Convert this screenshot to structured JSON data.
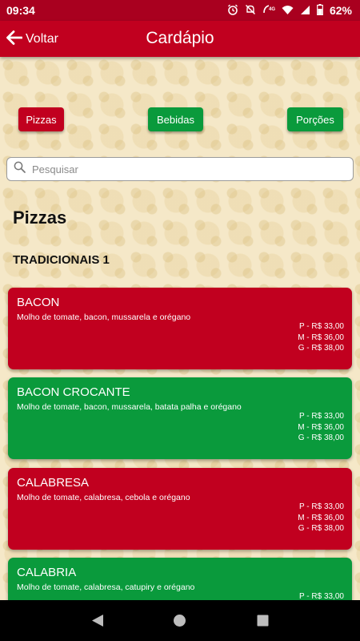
{
  "status_bar": {
    "time": "09:34",
    "battery": "62%",
    "network": "4G",
    "icons": [
      "alarm-icon",
      "mute-icon",
      "signal-4g-icon",
      "wifi-icon",
      "cell-signal-icon",
      "battery-icon"
    ]
  },
  "app_bar": {
    "back_label": "Voltar",
    "title": "Cardápio"
  },
  "categories": [
    {
      "label": "Pizzas",
      "color": "#c1001f"
    },
    {
      "label": "Bebidas",
      "color": "#0a9a3c"
    },
    {
      "label": "Porções",
      "color": "#0a9a3c"
    }
  ],
  "search": {
    "placeholder": "Pesquisar",
    "value": ""
  },
  "section_title": "Pizzas",
  "subsection_title": "TRADICIONAIS 1",
  "items": [
    {
      "name": "BACON",
      "description": "Molho de tomate, bacon, mussarela e orégano",
      "prices": [
        "P - R$ 33,00",
        "M - R$ 36,00",
        "G - R$ 38,00"
      ],
      "color": "#c1001f"
    },
    {
      "name": "BACON CROCANTE",
      "description": "Molho de tomate, bacon, mussarela, batata palha e orégano",
      "prices": [
        "P - R$ 33,00",
        "M - R$ 36,00",
        "G - R$ 38,00"
      ],
      "color": "#0a9a3c"
    },
    {
      "name": "CALABRESA",
      "description": "Molho de tomate, calabresa, cebola e orégano",
      "prices": [
        "P - R$ 33,00",
        "M - R$ 36,00",
        "G - R$ 38,00"
      ],
      "color": "#c1001f"
    },
    {
      "name": "CALABRIA",
      "description": "Molho de tomate, calabresa, catupiry e orégano",
      "prices": [
        "P - R$ 33,00"
      ],
      "color": "#0a9a3c"
    }
  ],
  "nav_bar": {
    "buttons": [
      "back-triangle-icon",
      "home-circle-icon",
      "recents-square-icon"
    ]
  },
  "colors": {
    "primary_red": "#c1001f",
    "primary_green": "#0a9a3c",
    "status_bar": "#a9001f",
    "background": "#f5e8c8"
  }
}
